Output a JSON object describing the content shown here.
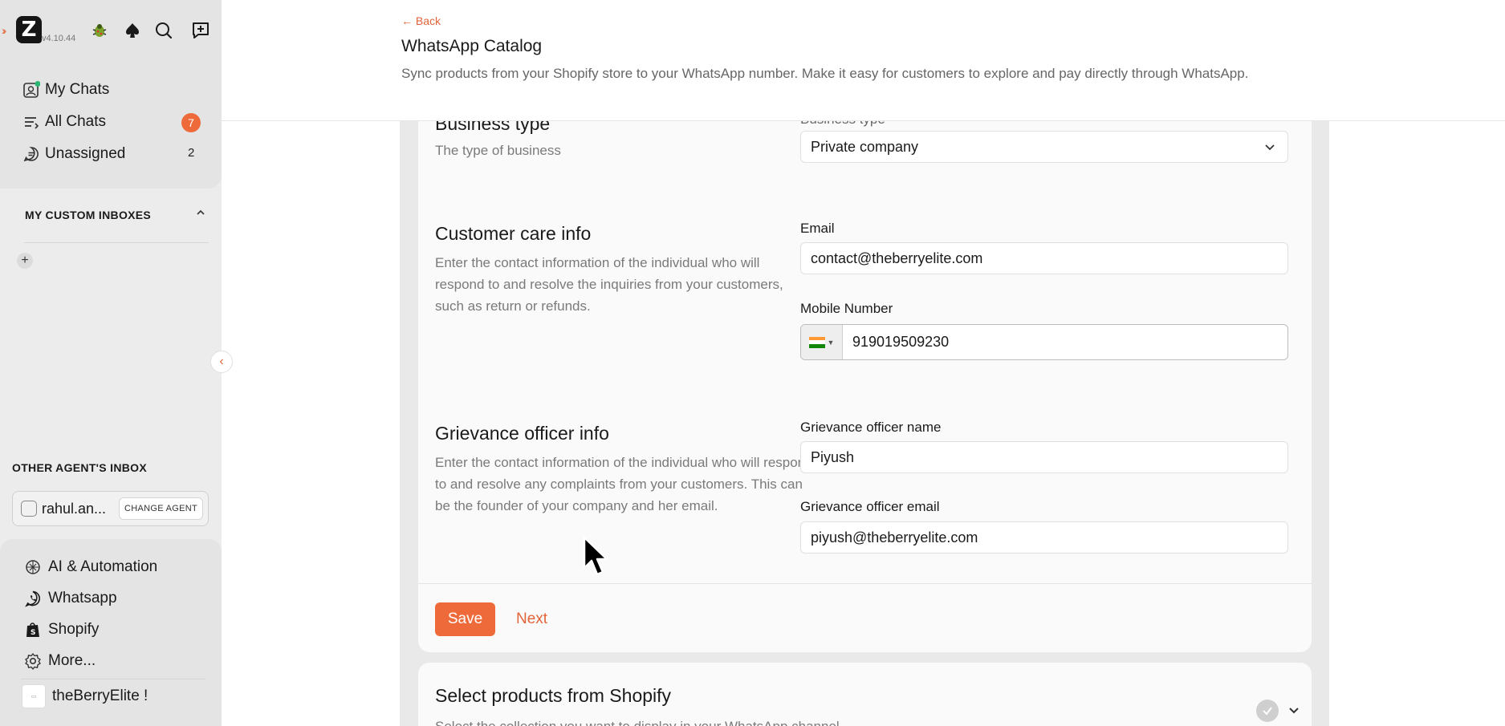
{
  "app": {
    "version": "v4.10.44",
    "logo_letter": "Z"
  },
  "sidebar": {
    "nav": [
      {
        "label": "My Chats",
        "icon": "my-chats-icon"
      },
      {
        "label": "All Chats",
        "icon": "all-chats-icon",
        "badge": "7"
      },
      {
        "label": "Unassigned",
        "icon": "unassigned-icon",
        "count": "2"
      }
    ],
    "custom_inboxes_title": "MY CUSTOM INBOXES",
    "add_inbox": "+",
    "other_agents_title": "OTHER AGENT'S INBOX",
    "agent": {
      "name": "rahul.an...",
      "change_label": "CHANGE AGENT"
    },
    "bottom": [
      {
        "label": "AI & Automation",
        "icon": "ai-automation-icon"
      },
      {
        "label": "Whatsapp",
        "icon": "whatsapp-icon"
      },
      {
        "label": "Shopify",
        "icon": "shopify-icon"
      },
      {
        "label": "More...",
        "icon": "gear-icon"
      }
    ],
    "store_name": "theBerryElite !"
  },
  "header": {
    "back_label": "← Back",
    "title": "WhatsApp Catalog",
    "description": "Sync products from your Shopify store to your WhatsApp number. Make it easy for customers to explore and pay directly through WhatsApp."
  },
  "form": {
    "business_type": {
      "title": "Business type",
      "description": "The type of business",
      "field_label": "Business type",
      "value": "Private company"
    },
    "customer_care": {
      "title": "Customer care info",
      "description": "Enter the contact information of the individual who will respond to and resolve the inquiries from your customers, such as return or refunds.",
      "email_label": "Email",
      "email_value": "contact@theberryelite.com",
      "mobile_label": "Mobile Number",
      "mobile_value": "919019509230",
      "country_flag": "india-flag-icon"
    },
    "grievance": {
      "title": "Grievance officer info",
      "description": "Enter the contact information of the individual who will respond to and resolve any complaints from your customers. This can be the founder of your company and her email.",
      "name_label": "Grievance officer name",
      "name_value": "Piyush",
      "email_label": "Grievance officer email",
      "email_value": "piyush@theberryelite.com"
    },
    "save_label": "Save",
    "next_label": "Next"
  },
  "products_section": {
    "title": "Select products from Shopify",
    "subtitle": "Select the collection you want to display in your WhatsApp channel"
  },
  "colors": {
    "accent": "#ef6a3a",
    "sidebar_bg": "#e4e4e4",
    "content_bg": "#e9e9e9"
  }
}
